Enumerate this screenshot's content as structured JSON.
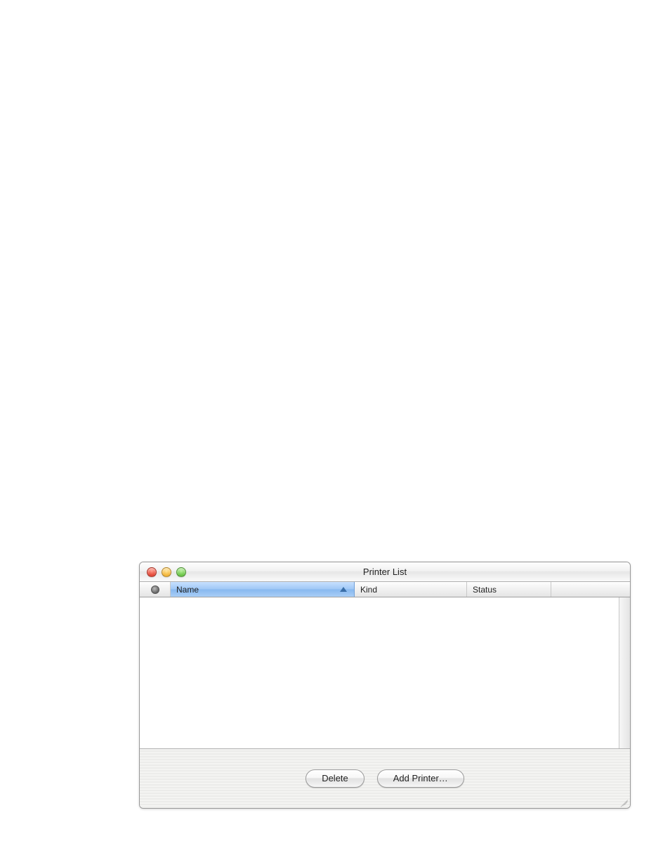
{
  "links": {
    "a": " ",
    "b": " ",
    "c": " ",
    "d": " ",
    "e": " "
  },
  "window": {
    "title": "Printer List",
    "columns": {
      "name": "Name",
      "kind": "Kind",
      "status": "Status"
    }
  },
  "buttons": {
    "delete": "Delete",
    "add": "Add Printer…"
  }
}
